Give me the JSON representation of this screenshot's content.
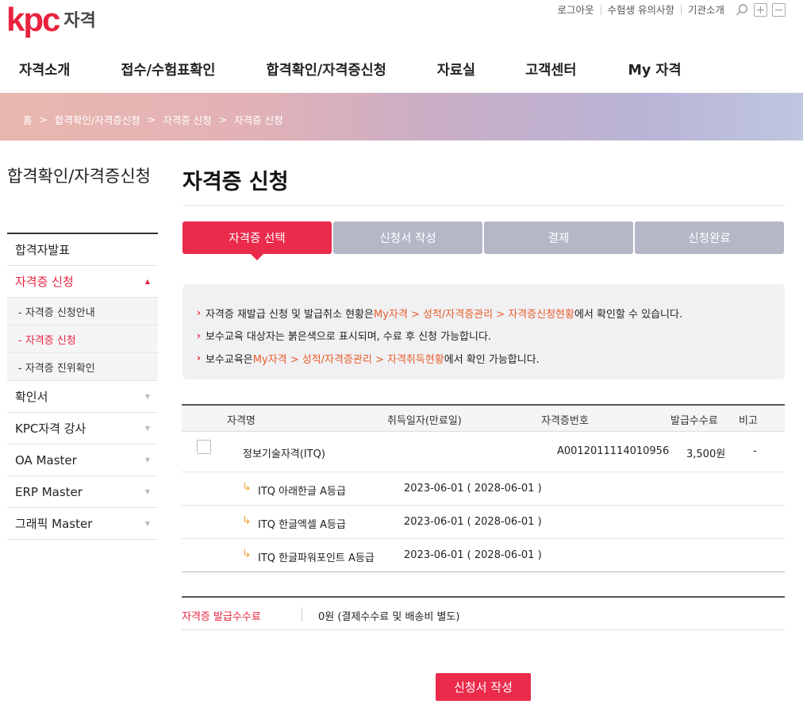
{
  "brand": {
    "logo_text": "kpc",
    "logo_sub": "자격",
    "accent": "#e8233f"
  },
  "util": {
    "links": [
      "로그아웃",
      "수험생 유의사항",
      "기관소개"
    ]
  },
  "gnb": [
    "자격소개",
    "접수/수험표확인",
    "합격확인/자격증신청",
    "자료실",
    "고객센터",
    "My 자격"
  ],
  "breadcrumb": [
    "홈",
    "합격확인/자격증신청",
    "자격증 신청",
    "자격증 신청"
  ],
  "sidebar": {
    "title": "합격확인/자격증신청",
    "items": [
      {
        "label": "합격자발표"
      },
      {
        "label": "자격증 신청",
        "active": true
      },
      {
        "label": "확인서"
      },
      {
        "label": "KPC자격 강사"
      },
      {
        "label": "OA Master"
      },
      {
        "label": "ERP Master"
      },
      {
        "label": "그래픽 Master"
      }
    ],
    "subitems": [
      "- 자격증 신청안내",
      "- 자격증 신청",
      "- 자격증 진위확인"
    ]
  },
  "page": {
    "title": "자격증 신청"
  },
  "steps": [
    "자격증 선택",
    "신청서 작성",
    "결제",
    "신청완료"
  ],
  "notice": [
    {
      "pre": "자격증 재발급 신청 및 발급취소 현황은 ",
      "hl": "My자격 > 성적/자격증관리 > 자격증신청현황",
      "post": "에서 확인할 수 있습니다."
    },
    {
      "pre": "보수교육 대상자는 붉은색으로 표시되며, 수료 후 신청 가능합니다.",
      "hl": "",
      "post": ""
    },
    {
      "pre": "보수교육은 ",
      "hl": "My자격 > 성적/자격증관리 > 자격취득현황",
      "post": "에서 확인 가능합니다."
    }
  ],
  "table": {
    "headers": [
      "자격명",
      "취득일자(만료일)",
      "자격증번호",
      "발급수수료",
      "비고"
    ],
    "main_row": {
      "name": "정보기술자격(ITQ)",
      "cert_no": "A0012011114010956",
      "fee": "3,500원",
      "note": "-"
    },
    "sub_rows": [
      {
        "name": "ITQ 아래한글 A등급",
        "date": "2023-06-01 ( 2028-06-01 )"
      },
      {
        "name": "ITQ 한글엑셀 A등급",
        "date": "2023-06-01 ( 2028-06-01 )"
      },
      {
        "name": "ITQ 한글파워포인트 A등급",
        "date": "2023-06-01 ( 2028-06-01 )"
      }
    ]
  },
  "fee": {
    "label": "자격증 발급수수료",
    "value": "0원 (결제수수료 및 배송비 별도)"
  },
  "submit_label": "신청서 작성"
}
